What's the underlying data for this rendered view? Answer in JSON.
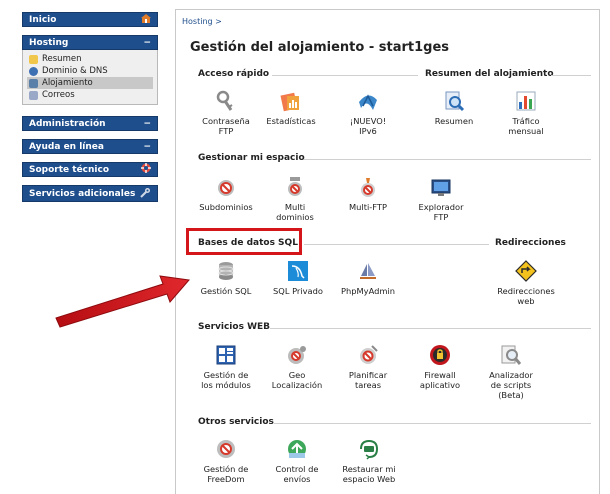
{
  "sidebar": {
    "inicio": "Inicio",
    "hosting": "Hosting",
    "hosting_collapse": "−",
    "hosting_items": [
      "Resumen",
      "Dominio & DNS",
      "Alojamiento",
      "Correos"
    ],
    "administracion": "Administración",
    "ayuda": "Ayuda en línea",
    "soporte": "Soporte técnico",
    "servicios": "Servicios adicionales",
    "collapse": "−"
  },
  "breadcrumb": "Hosting >",
  "title": "Gestión del alojamiento - start1ges",
  "sections": {
    "acceso_rapido": "Acceso rápido",
    "resumen": "Resumen del alojamiento",
    "gestionar": "Gestionar mi espacio",
    "bases": "Bases de datos SQL",
    "redirecciones": "Redirecciones",
    "servicios_web": "Servicios WEB",
    "otros": "Otros servicios"
  },
  "tools": {
    "contrasena": [
      "Contraseña",
      "FTP"
    ],
    "estadisticas": [
      "Estadísticas"
    ],
    "nuevo_ipv6": [
      "¡NUEVO!",
      "IPv6"
    ],
    "resumen": [
      "Resumen"
    ],
    "trafico": [
      "Tráfico",
      "mensual"
    ],
    "subdominios": [
      "Subdominios"
    ],
    "multi_dominios": [
      "Multi",
      "dominios"
    ],
    "multi_ftp": [
      "Multi-FTP"
    ],
    "explorador": [
      "Explorador",
      "FTP"
    ],
    "gestion_sql": [
      "Gestión SQL"
    ],
    "sql_privado": [
      "SQL Privado"
    ],
    "phpmyadmin": [
      "PhpMyAdmin"
    ],
    "redirecciones_web": [
      "Redirecciones",
      "web"
    ],
    "gestion_modulos": [
      "Gestión de",
      "los módulos"
    ],
    "geo": [
      "Geo",
      "Localización"
    ],
    "planificar": [
      "Planificar",
      "tareas"
    ],
    "firewall": [
      "Firewall",
      "aplicativo"
    ],
    "analizador": [
      "Analizador",
      "de scripts",
      "(Beta)"
    ],
    "freedom": [
      "Gestión de",
      "FreeDom"
    ],
    "control_envios": [
      "Control de",
      "envíos"
    ],
    "restaurar": [
      "Restaurar mi",
      "espacio Web"
    ]
  },
  "colors": {
    "sidebar_bar": "#1f4e8c",
    "highlight": "#d4151a",
    "arrow": "#d4151a"
  }
}
